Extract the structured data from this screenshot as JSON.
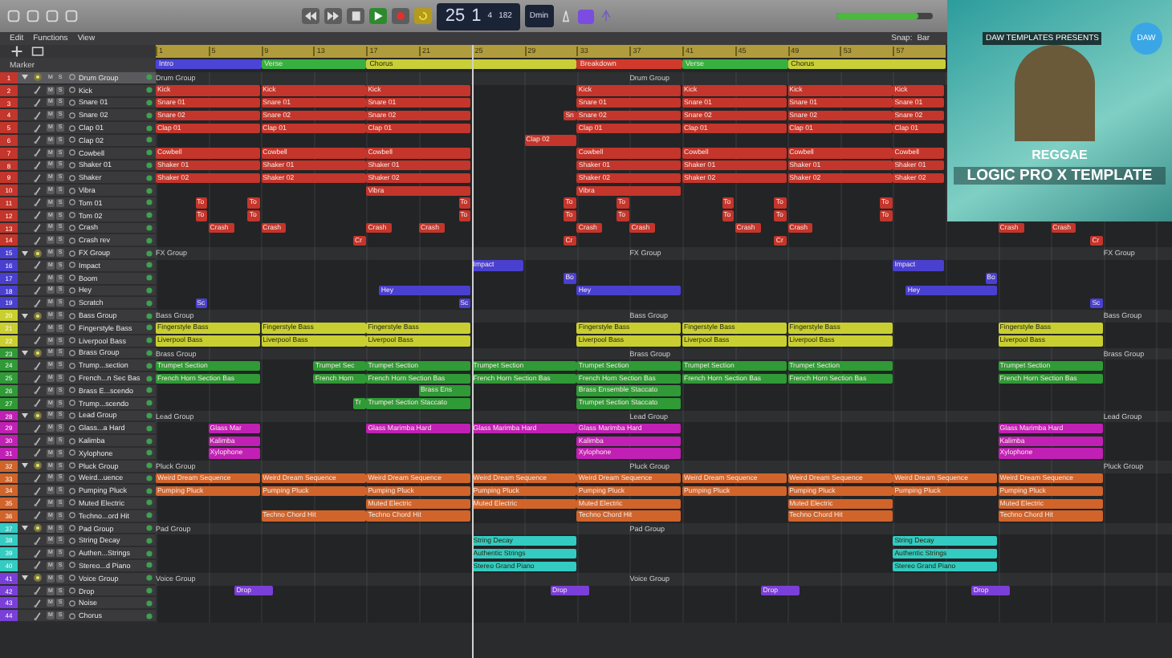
{
  "toolbar": {
    "transport": {
      "playing": true,
      "cycle": true
    },
    "lcd": {
      "bar": "25",
      "beat": "1",
      "time_signature": "4",
      "tempo": "182"
    },
    "key": "Dmin",
    "master_volume": {
      "level": 0.85
    }
  },
  "menus": [
    "Edit",
    "Functions",
    "View"
  ],
  "snap": {
    "label": "Snap:",
    "value": "Bar"
  },
  "marker_header": "Marker",
  "ruler": [
    "1",
    "5",
    "9",
    "13",
    "17",
    "21",
    "25",
    "29",
    "33",
    "37",
    "41",
    "45",
    "49",
    "53",
    "57"
  ],
  "markers": [
    {
      "label": "Intro",
      "color": "#4b45d6"
    },
    {
      "label": "Verse",
      "color": "#38b040"
    },
    {
      "label": "Chorus",
      "color": "#c8cf38"
    },
    {
      "label": "Breakdown",
      "color": "#cf3a2c"
    },
    {
      "label": "Verse",
      "color": "#38b040"
    },
    {
      "label": "Chorus",
      "color": "#c8cf38"
    }
  ],
  "groups": [
    {
      "color": "#c4352b",
      "tracks": [
        {
          "number": "1",
          "name": "Drum Group",
          "kind": "group",
          "selected": true,
          "mute": "M",
          "solo": "S",
          "regions": [
            "Drum Group",
            "Drum Group"
          ]
        },
        {
          "number": "2",
          "name": "Kick",
          "kind": "track",
          "selected": false,
          "mute": "M",
          "solo": "S",
          "regions": [
            "Kick",
            "Kick",
            "Kick",
            "Kick",
            "Kick",
            "Kick",
            "Kick"
          ]
        },
        {
          "number": "3",
          "name": "Snare 01",
          "kind": "track",
          "selected": false,
          "mute": "M",
          "solo": "S",
          "regions": [
            "Snare 01",
            "Snare 01",
            "Snare 01",
            "Snare 01",
            "Snare 01",
            "Snare 01",
            "Snare 01"
          ]
        },
        {
          "number": "4",
          "name": "Snare 02",
          "kind": "track",
          "selected": false,
          "mute": "M",
          "solo": "S",
          "regions": [
            "Snare 02",
            "Snare 02",
            "Snare 02",
            "Sn",
            "Snare 02",
            "Snare 02",
            "Snare 02",
            "Snare 02"
          ]
        },
        {
          "number": "5",
          "name": "Clap 01",
          "kind": "track",
          "selected": false,
          "mute": "M",
          "solo": "S",
          "regions": [
            "Clap 01",
            "Clap 01",
            "Clap 01",
            "Clap 01",
            "Clap 01",
            "Clap 01",
            "Clap 01"
          ]
        },
        {
          "number": "6",
          "name": "Clap 02",
          "kind": "track",
          "selected": false,
          "mute": "M",
          "solo": "S",
          "regions": [
            "Clap 02"
          ]
        },
        {
          "number": "7",
          "name": "Cowbell",
          "kind": "track",
          "selected": false,
          "mute": "M",
          "solo": "S",
          "regions": [
            "Cowbell",
            "Cowbell",
            "Cowbell",
            "Cowbell",
            "Cowbell",
            "Cowbell",
            "Cowbell"
          ]
        },
        {
          "number": "8",
          "name": "Shaker 01",
          "kind": "track",
          "selected": false,
          "mute": "M",
          "solo": "S",
          "regions": [
            "Shaker 01",
            "Shaker 01",
            "Shaker 01",
            "Shaker 01",
            "Shaker 01",
            "Shaker 01",
            "Shaker 01"
          ]
        },
        {
          "number": "9",
          "name": "Shaker",
          "kind": "track",
          "selected": false,
          "mute": "M",
          "solo": "S",
          "regions": [
            "Shaker 02",
            "Shaker 02",
            "Shaker 02",
            "Shaker 02",
            "Shaker 02",
            "Shaker 02",
            "Shaker 02"
          ]
        },
        {
          "number": "10",
          "name": "Vibra",
          "kind": "track",
          "selected": false,
          "mute": "M",
          "solo": "S",
          "regions": [
            "Vibra",
            "Vibra"
          ]
        },
        {
          "number": "11",
          "name": "Tom 01",
          "kind": "track",
          "selected": false,
          "mute": "M",
          "solo": "S",
          "regions": [
            "To",
            "To",
            "To",
            "To",
            "To",
            "To",
            "To",
            "To"
          ]
        },
        {
          "number": "12",
          "name": "Tom 02",
          "kind": "track",
          "selected": false,
          "mute": "M",
          "solo": "S",
          "regions": [
            "To",
            "To",
            "To",
            "To",
            "To",
            "To",
            "To",
            "To"
          ]
        },
        {
          "number": "13",
          "name": "Crash",
          "kind": "track",
          "selected": false,
          "mute": "M",
          "solo": "S",
          "regions": [
            "Crash",
            "Crash",
            "Crash",
            "Crash",
            "Crash",
            "Crash",
            "Crash",
            "Crash",
            "Crash",
            "Crash"
          ]
        },
        {
          "number": "14",
          "name": "Crash rev",
          "kind": "track",
          "selected": false,
          "mute": "M",
          "solo": "S",
          "regions": [
            "Cr",
            "Cr",
            "Cr",
            "Cr"
          ]
        }
      ]
    },
    {
      "color": "#4a40d0",
      "tracks": [
        {
          "number": "15",
          "name": "FX Group",
          "kind": "group",
          "selected": false,
          "mute": "M",
          "solo": "S",
          "regions": [
            "FX Group",
            "FX Group",
            "FX Group"
          ]
        },
        {
          "number": "16",
          "name": "Impact",
          "kind": "track",
          "selected": false,
          "mute": "M",
          "solo": "S",
          "regions": [
            "Impact",
            "Impact"
          ]
        },
        {
          "number": "17",
          "name": "Boom",
          "kind": "track",
          "selected": false,
          "mute": "M",
          "solo": "S",
          "regions": [
            "Bo",
            "Bo"
          ]
        },
        {
          "number": "18",
          "name": "Hey",
          "kind": "track",
          "selected": false,
          "mute": "M",
          "solo": "S",
          "regions": [
            "Hey",
            "Hey",
            "Hey"
          ]
        },
        {
          "number": "19",
          "name": "Scratch",
          "kind": "track",
          "selected": false,
          "mute": "M",
          "solo": "S",
          "regions": [
            "Sc",
            "Sc",
            "Sc"
          ]
        }
      ]
    },
    {
      "color": "#c9cf30",
      "tracks": [
        {
          "number": "20",
          "name": "Bass Group",
          "kind": "group",
          "selected": false,
          "mute": "M",
          "solo": "S",
          "regions": [
            "Bass Group",
            "Bass Group",
            "Bass Group"
          ]
        },
        {
          "number": "21",
          "name": "Fingerstyle Bass",
          "kind": "track",
          "selected": false,
          "mute": "M",
          "solo": "S",
          "regions": [
            "Fingerstyle Bass",
            "Fingerstyle Bass",
            "Fingerstyle Bass",
            "Fingerstyle Bass",
            "Fingerstyle Bass",
            "Fingerstyle Bass",
            "Fingerstyle Bass"
          ]
        },
        {
          "number": "22",
          "name": "Liverpool Bass",
          "kind": "track",
          "selected": false,
          "mute": "M",
          "solo": "S",
          "regions": [
            "Liverpool Bass",
            "Liverpool Bass",
            "Liverpool Bass",
            "Liverpool Bass",
            "Liverpool Bass",
            "Liverpool Bass",
            "Liverpool Bass"
          ]
        }
      ]
    },
    {
      "color": "#2f9a36",
      "tracks": [
        {
          "number": "23",
          "name": "Brass Group",
          "kind": "group",
          "selected": false,
          "mute": "M",
          "solo": "S",
          "regions": [
            "Brass Group",
            "Brass Group",
            "Brass Group"
          ]
        },
        {
          "number": "24",
          "name": "Trump...section",
          "kind": "track",
          "selected": false,
          "mute": "M",
          "solo": "S",
          "regions": [
            "Trumpet Section",
            "Trumpet Sec",
            "Trumpet Section",
            "Trumpet Section",
            "Trumpet Section",
            "Trumpet Section",
            "Trumpet Section",
            "Trumpet Section"
          ]
        },
        {
          "number": "25",
          "name": "French...n Sec Bas",
          "kind": "track",
          "selected": false,
          "mute": "M",
          "solo": "S",
          "regions": [
            "French Horn Section Bas",
            "French Horn",
            "French Horn Section Bas",
            "French Horn Section Bas",
            "French Horn Section Bas",
            "French Horn Section Bas",
            "French Horn Section Bas",
            "French Horn Section Bas"
          ]
        },
        {
          "number": "26",
          "name": "Brass E...scendo",
          "kind": "track",
          "selected": false,
          "mute": "M",
          "solo": "S",
          "regions": [
            "Brass Ens",
            "Brass Ensemble Staccato"
          ]
        },
        {
          "number": "27",
          "name": "Trump...scendo",
          "kind": "track",
          "selected": false,
          "mute": "M",
          "solo": "S",
          "regions": [
            "Tr",
            "Trumpet Section Staccato",
            "Trumpet Section Staccato"
          ]
        }
      ]
    },
    {
      "color": "#c020b4",
      "tracks": [
        {
          "number": "28",
          "name": "Lead Group",
          "kind": "group",
          "selected": false,
          "mute": "M",
          "solo": "S",
          "regions": [
            "Lead Group",
            "Lead Group",
            "Lead Group"
          ]
        },
        {
          "number": "29",
          "name": "Glass...a Hard",
          "kind": "track",
          "selected": false,
          "mute": "M",
          "solo": "S",
          "regions": [
            "Glass Mar",
            "Glass Marimba Hard",
            "Glass Marimba Hard",
            "Glass Marimba Hard",
            "Glass Marimba Hard"
          ]
        },
        {
          "number": "30",
          "name": "Kalimba",
          "kind": "track",
          "selected": false,
          "mute": "M",
          "solo": "S",
          "regions": [
            "Kalimba",
            "Kalimba",
            "Kalimba"
          ]
        },
        {
          "number": "31",
          "name": "Xylophone",
          "kind": "track",
          "selected": false,
          "mute": "M",
          "solo": "S",
          "regions": [
            "Xylophone",
            "Xylophone",
            "Xylophone"
          ]
        }
      ]
    },
    {
      "color": "#d0642b",
      "tracks": [
        {
          "number": "32",
          "name": "Pluck Group",
          "kind": "group",
          "selected": false,
          "mute": "M",
          "solo": "S",
          "regions": [
            "Pluck Group",
            "Pluck Group",
            "Pluck Group"
          ]
        },
        {
          "number": "33",
          "name": "Weird...uence",
          "kind": "track",
          "selected": false,
          "mute": "M",
          "solo": "S",
          "regions": [
            "Weird Dream Sequence",
            "Weird Dream Sequence",
            "Weird Dream Sequence",
            "Weird Dream Sequence",
            "Weird Dream Sequence",
            "Weird Dream Sequence",
            "Weird Dream Sequence",
            "Weird Dream Sequence",
            "Weird Dream Sequence"
          ]
        },
        {
          "number": "34",
          "name": "Pumping Pluck",
          "kind": "track",
          "selected": false,
          "mute": "M",
          "solo": "S",
          "regions": [
            "Pumping Pluck",
            "Pumping Pluck",
            "Pumping Pluck",
            "Pumping Pluck",
            "Pumping Pluck",
            "Pumping Pluck",
            "Pumping Pluck",
            "Pumping Pluck",
            "Pumping Pluck"
          ]
        },
        {
          "number": "35",
          "name": "Muted Electric",
          "kind": "track",
          "selected": false,
          "mute": "M",
          "solo": "S",
          "regions": [
            "Muted Electric",
            "Muted Electric",
            "Muted Electric",
            "Muted Electric",
            "Muted Electric"
          ]
        },
        {
          "number": "36",
          "name": "Techno...ord Hit",
          "kind": "track",
          "selected": false,
          "mute": "M",
          "solo": "S",
          "regions": [
            "Techno Chord Hit",
            "Techno Chord Hit",
            "Techno Chord Hit",
            "Techno Chord Hit",
            "Techno Chord Hit"
          ]
        }
      ]
    },
    {
      "color": "#33cbc2",
      "tracks": [
        {
          "number": "37",
          "name": "Pad Group",
          "kind": "group",
          "selected": false,
          "mute": "M",
          "solo": "S",
          "regions": [
            "Pad Group",
            "Pad Group"
          ]
        },
        {
          "number": "38",
          "name": "String Decay",
          "kind": "track",
          "selected": false,
          "mute": "M",
          "solo": "S",
          "regions": [
            "String Decay",
            "String Decay"
          ]
        },
        {
          "number": "39",
          "name": "Authen...Strings",
          "kind": "track",
          "selected": false,
          "mute": "M",
          "solo": "S",
          "regions": [
            "Authentic Strings",
            "Authentic Strings"
          ]
        },
        {
          "number": "40",
          "name": "Stereo...d Piano",
          "kind": "track",
          "selected": false,
          "mute": "M",
          "solo": "S",
          "regions": [
            "Stereo Grand Piano",
            "Stereo Grand Piano"
          ]
        }
      ]
    },
    {
      "color": "#7a3fd8",
      "tracks": [
        {
          "number": "41",
          "name": "Voice Group",
          "kind": "group",
          "selected": false,
          "mute": "M",
          "solo": "S",
          "regions": [
            "Voice Group",
            "Voice Group"
          ]
        },
        {
          "number": "42",
          "name": "Drop",
          "kind": "track",
          "selected": false,
          "mute": "M",
          "solo": "S",
          "regions": [
            "Drop",
            "Drop",
            "Drop",
            "Drop"
          ]
        },
        {
          "number": "43",
          "name": "Noise",
          "kind": "track",
          "selected": false,
          "mute": "M",
          "solo": "S"
        },
        {
          "number": "44",
          "name": "Chorus",
          "kind": "track",
          "selected": false,
          "mute": "M",
          "solo": "S"
        }
      ]
    }
  ],
  "promo": {
    "presenter": "DAW TEMPLATES PRESENTS",
    "logo": "DAW",
    "genre": "REGGAE",
    "title": "LOGIC PRO X TEMPLATE"
  }
}
